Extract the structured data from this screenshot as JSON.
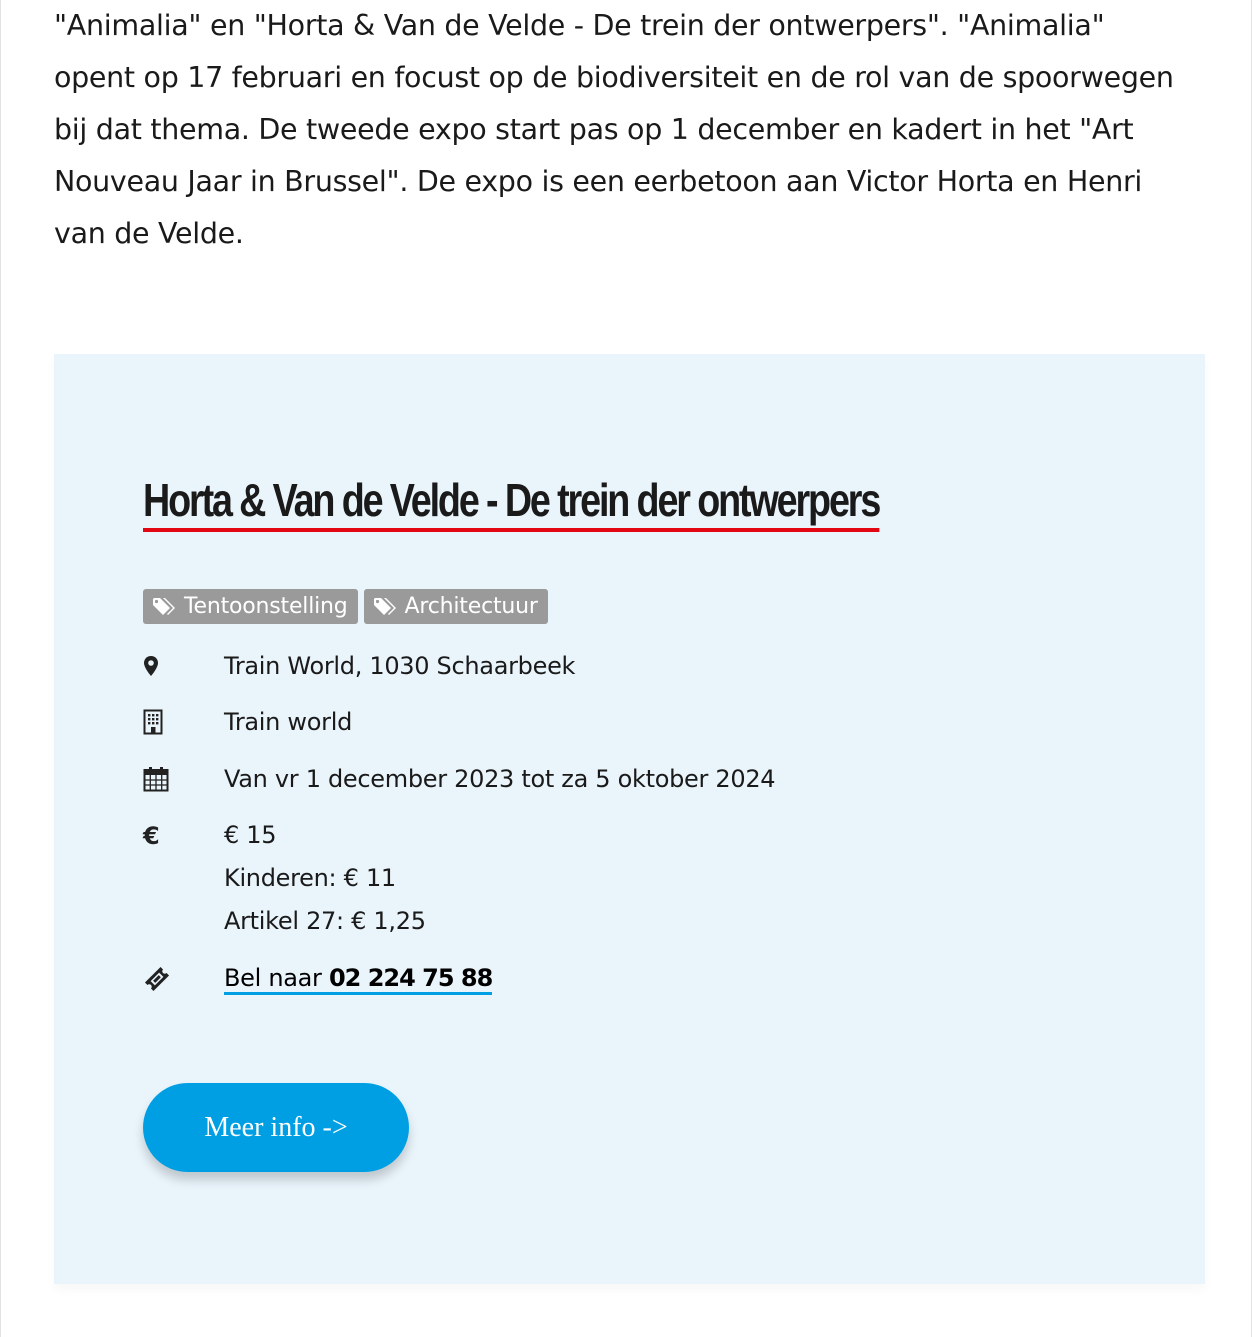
{
  "article": {
    "intro_lines": [
      "\"Animalia\" en \"Horta & Van de Velde - De trein der ontwerpers\". \"Animalia\"",
      "opent op 17 februari en focust op de biodiversiteit en de rol van de spoorwegen",
      "bij dat thema. De tweede expo start pas op 1 december en kadert in het \"Art",
      "Nouveau Jaar in Brussel\". De expo is een eerbetoon aan Victor Horta en Henri",
      "van de Velde."
    ]
  },
  "event": {
    "title": "Horta & Van de Velde - De trein der ontwerpers",
    "tags": [
      {
        "label": "Tentoonstelling",
        "icon": "tag-icon"
      },
      {
        "label": "Architectuur",
        "icon": "tag-icon"
      }
    ],
    "location": {
      "icon": "map-marker-icon",
      "text": "Train World, 1030 Schaarbeek"
    },
    "venue": {
      "icon": "building-icon",
      "text": "Train world"
    },
    "dates": {
      "icon": "calendar-icon",
      "text": "Van vr 1 december 2023 tot za 5 oktober 2024"
    },
    "price": {
      "icon": "euro-icon",
      "lines": [
        "€ 15",
        "Kinderen: € 11",
        "Artikel 27: € 1,25"
      ]
    },
    "tickets": {
      "icon": "ticket-icon",
      "prefix": "Bel naar ",
      "phone": "02 224 75 88"
    },
    "more_button": "Meer info ->"
  },
  "colors": {
    "card_background": "#e9f4fb",
    "title_underline": "#e30613",
    "tag_background": "#9a9a9a",
    "link_underline": "#009fe3",
    "button_background": "#009fe3"
  }
}
